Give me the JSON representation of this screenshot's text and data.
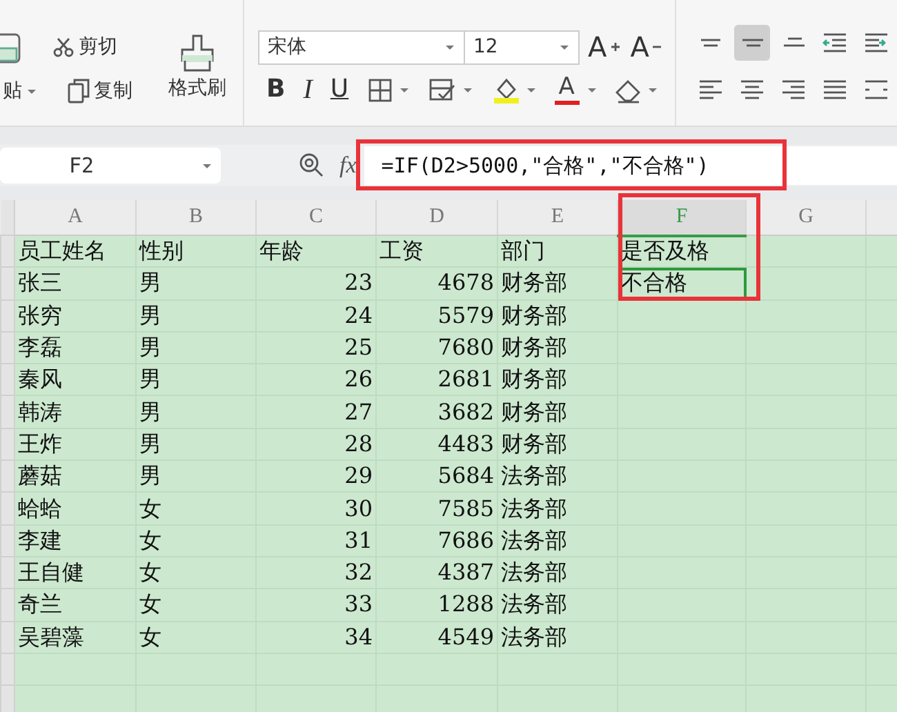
{
  "ribbon": {
    "clipboard": {
      "paste_label": "贴",
      "cut_label": "剪切",
      "copy_label": "复制",
      "format_painter_label": "格式刷"
    },
    "font": {
      "name": "宋体",
      "size": "12",
      "grow_label": "A",
      "shrink_label": "A",
      "bold_label": "B",
      "italic_label": "I",
      "underline_label": "U",
      "font_color_label": "A"
    },
    "alignment": [
      {
        "kind": "top",
        "selected": false
      },
      {
        "kind": "middle",
        "selected": true
      },
      {
        "kind": "bottom",
        "selected": false
      },
      {
        "kind": "outdent",
        "selected": false
      },
      {
        "kind": "indent",
        "selected": false
      },
      {
        "kind": "left",
        "selected": false
      },
      {
        "kind": "center",
        "selected": false
      },
      {
        "kind": "right",
        "selected": false
      },
      {
        "kind": "justify",
        "selected": false
      },
      {
        "kind": "distributed",
        "selected": false
      }
    ]
  },
  "formula_bar": {
    "cell_ref": "F2",
    "fx_label": "fx",
    "formula": "=IF(D2>5000,\"合格\",\"不合格\")",
    "highlighted": true
  },
  "sheet": {
    "columns": [
      {
        "label": "A",
        "kind": "text",
        "selected": false,
        "highlighted": false
      },
      {
        "label": "B",
        "kind": "text",
        "selected": false,
        "highlighted": false
      },
      {
        "label": "C",
        "kind": "number",
        "selected": false,
        "highlighted": false
      },
      {
        "label": "D",
        "kind": "number",
        "selected": false,
        "highlighted": false
      },
      {
        "label": "E",
        "kind": "text",
        "selected": false,
        "highlighted": false
      },
      {
        "label": "F",
        "kind": "text",
        "selected": true,
        "highlighted": true
      },
      {
        "label": "G",
        "kind": "text",
        "selected": false,
        "highlighted": false
      }
    ],
    "rows": [
      {
        "kind": "header",
        "active": false,
        "cells": [
          "员工姓名",
          "性别",
          "年龄",
          "工资",
          "部门",
          "是否及格"
        ]
      },
      {
        "kind": "data",
        "active": true,
        "cells": [
          "张三",
          "男",
          "23",
          "4678",
          "财务部",
          "不合格"
        ]
      },
      {
        "kind": "data",
        "active": false,
        "cells": [
          "张穷",
          "男",
          "24",
          "5579",
          "财务部"
        ]
      },
      {
        "kind": "data",
        "active": false,
        "cells": [
          "李磊",
          "男",
          "25",
          "7680",
          "财务部"
        ]
      },
      {
        "kind": "data",
        "active": false,
        "cells": [
          "秦风",
          "男",
          "26",
          "2681",
          "财务部"
        ]
      },
      {
        "kind": "data",
        "active": false,
        "cells": [
          "韩涛",
          "男",
          "27",
          "3682",
          "财务部"
        ]
      },
      {
        "kind": "data",
        "active": false,
        "cells": [
          "王炸",
          "男",
          "28",
          "4483",
          "财务部"
        ]
      },
      {
        "kind": "data",
        "active": false,
        "cells": [
          "蘑菇",
          "男",
          "29",
          "5684",
          "法务部"
        ]
      },
      {
        "kind": "data",
        "active": false,
        "cells": [
          "蛤蛤",
          "女",
          "30",
          "7585",
          "法务部"
        ]
      },
      {
        "kind": "data",
        "active": false,
        "cells": [
          "李建",
          "女",
          "31",
          "7686",
          "法务部"
        ]
      },
      {
        "kind": "data",
        "active": false,
        "cells": [
          "王自健",
          "女",
          "32",
          "4387",
          "法务部"
        ]
      },
      {
        "kind": "data",
        "active": false,
        "cells": [
          "奇兰",
          "女",
          "33",
          "1288",
          "法务部"
        ]
      },
      {
        "kind": "data",
        "active": false,
        "cells": [
          "吴碧藻",
          "女",
          "34",
          "4549",
          "法务部"
        ]
      },
      {
        "kind": "data",
        "active": false,
        "cells": []
      },
      {
        "kind": "data",
        "active": false,
        "cells": []
      }
    ]
  }
}
